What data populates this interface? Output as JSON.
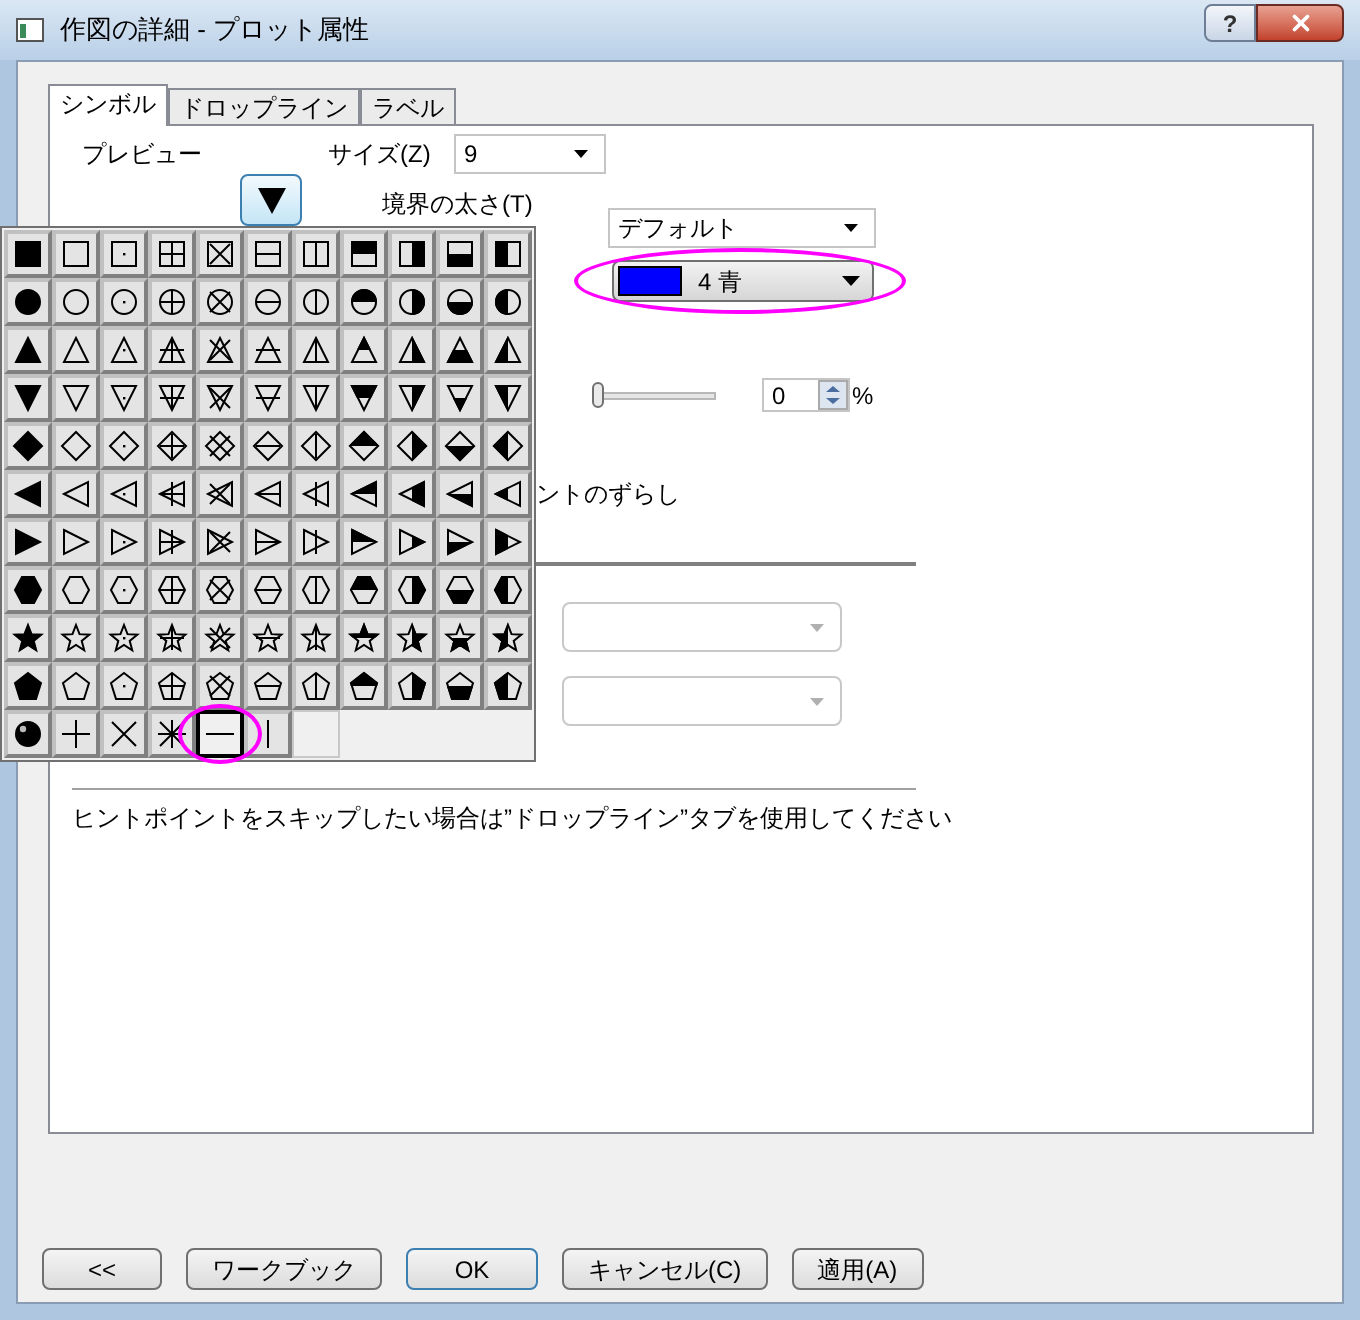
{
  "window": {
    "title": "作図の詳細 - プロット属性",
    "help_button": "?"
  },
  "tabs": [
    {
      "label": "シンボル",
      "selected": true
    },
    {
      "label": "ドロップライン",
      "selected": false
    },
    {
      "label": "ラベル",
      "selected": false
    }
  ],
  "symbol_tab": {
    "preview_label": "プレビュー",
    "size_label": "サイズ(Z)",
    "size_value": "9",
    "border_width_label": "境界の太さ(T)",
    "border_width_value": "デフォルト",
    "color_combo": {
      "color": "#0000ff",
      "label": "4 青"
    },
    "transparency": {
      "level": 0,
      "value": "0",
      "unit": "%"
    },
    "offset_label": "ントのずらし",
    "dropdowns": [
      {
        "disabled": true
      },
      {
        "disabled": true
      }
    ],
    "hint": "ヒントポイントをスキップしたい場合は”ドロップライン”タブを使用してください"
  },
  "symbol_palette": {
    "rows": [
      {
        "kind": "square",
        "cells": [
          {
            "kind": "filled",
            "selected": false
          },
          {
            "kind": "open",
            "selected": false
          },
          {
            "kind": "dot",
            "selected": false
          },
          {
            "kind": "plus",
            "selected": false
          },
          {
            "kind": "x",
            "selected": false
          },
          {
            "kind": "hline",
            "selected": false
          },
          {
            "kind": "vline",
            "selected": false
          },
          {
            "kind": "top",
            "selected": false
          },
          {
            "kind": "right",
            "selected": false
          },
          {
            "kind": "bottom",
            "selected": false
          },
          {
            "kind": "left",
            "selected": false
          }
        ]
      },
      {
        "kind": "circle",
        "cells": [
          {
            "kind": "filled",
            "selected": false
          },
          {
            "kind": "open",
            "selected": false
          },
          {
            "kind": "dot",
            "selected": false
          },
          {
            "kind": "plus",
            "selected": false
          },
          {
            "kind": "x",
            "selected": false
          },
          {
            "kind": "hline",
            "selected": false
          },
          {
            "kind": "vline",
            "selected": false
          },
          {
            "kind": "top",
            "selected": false
          },
          {
            "kind": "right",
            "selected": false
          },
          {
            "kind": "bottom",
            "selected": false
          },
          {
            "kind": "left",
            "selected": false
          }
        ]
      },
      {
        "kind": "up-triangle",
        "cells": [
          {
            "kind": "filled",
            "selected": false
          },
          {
            "kind": "open",
            "selected": false
          },
          {
            "kind": "dot",
            "selected": false
          },
          {
            "kind": "plus",
            "selected": false
          },
          {
            "kind": "x",
            "selected": false
          },
          {
            "kind": "hline",
            "selected": false
          },
          {
            "kind": "vline",
            "selected": false
          },
          {
            "kind": "top",
            "selected": false
          },
          {
            "kind": "right",
            "selected": false
          },
          {
            "kind": "bottom",
            "selected": false
          },
          {
            "kind": "left",
            "selected": false
          }
        ]
      },
      {
        "kind": "down-triangle",
        "cells": [
          {
            "kind": "filled",
            "selected": false
          },
          {
            "kind": "open",
            "selected": false
          },
          {
            "kind": "dot",
            "selected": false
          },
          {
            "kind": "plus",
            "selected": false
          },
          {
            "kind": "x",
            "selected": false
          },
          {
            "kind": "hline",
            "selected": false
          },
          {
            "kind": "vline",
            "selected": false
          },
          {
            "kind": "top",
            "selected": false
          },
          {
            "kind": "right",
            "selected": false
          },
          {
            "kind": "bottom",
            "selected": false
          },
          {
            "kind": "left",
            "selected": false
          }
        ]
      },
      {
        "kind": "diamond",
        "cells": [
          {
            "kind": "filled",
            "selected": false
          },
          {
            "kind": "open",
            "selected": false
          },
          {
            "kind": "dot",
            "selected": false
          },
          {
            "kind": "plus",
            "selected": false
          },
          {
            "kind": "x",
            "selected": false
          },
          {
            "kind": "hline",
            "selected": false
          },
          {
            "kind": "vline",
            "selected": false
          },
          {
            "kind": "top",
            "selected": false
          },
          {
            "kind": "right",
            "selected": false
          },
          {
            "kind": "bottom",
            "selected": false
          },
          {
            "kind": "left",
            "selected": false
          }
        ]
      },
      {
        "kind": "left-triangle",
        "cells": [
          {
            "kind": "filled",
            "selected": false
          },
          {
            "kind": "open",
            "selected": false
          },
          {
            "kind": "dot",
            "selected": false
          },
          {
            "kind": "plus",
            "selected": false
          },
          {
            "kind": "x",
            "selected": false
          },
          {
            "kind": "hline",
            "selected": false
          },
          {
            "kind": "vline",
            "selected": false
          },
          {
            "kind": "top",
            "selected": false
          },
          {
            "kind": "right",
            "selected": false
          },
          {
            "kind": "bottom",
            "selected": false
          },
          {
            "kind": "left",
            "selected": false
          }
        ]
      },
      {
        "kind": "right-triangle",
        "cells": [
          {
            "kind": "filled",
            "selected": false
          },
          {
            "kind": "open",
            "selected": false
          },
          {
            "kind": "dot",
            "selected": false
          },
          {
            "kind": "plus",
            "selected": false
          },
          {
            "kind": "x",
            "selected": false
          },
          {
            "kind": "hline",
            "selected": false
          },
          {
            "kind": "vline",
            "selected": false
          },
          {
            "kind": "top",
            "selected": false
          },
          {
            "kind": "right",
            "selected": false
          },
          {
            "kind": "bottom",
            "selected": false
          },
          {
            "kind": "left",
            "selected": false
          }
        ]
      },
      {
        "kind": "hexagon",
        "cells": [
          {
            "kind": "filled",
            "selected": false
          },
          {
            "kind": "open",
            "selected": false
          },
          {
            "kind": "dot",
            "selected": false
          },
          {
            "kind": "plus",
            "selected": false
          },
          {
            "kind": "x",
            "selected": false
          },
          {
            "kind": "hline",
            "selected": false
          },
          {
            "kind": "vline",
            "selected": false
          },
          {
            "kind": "top",
            "selected": false
          },
          {
            "kind": "right",
            "selected": false
          },
          {
            "kind": "bottom",
            "selected": false
          },
          {
            "kind": "left",
            "selected": false
          }
        ]
      },
      {
        "kind": "star",
        "cells": [
          {
            "kind": "filled",
            "selected": false
          },
          {
            "kind": "open",
            "selected": false
          },
          {
            "kind": "dot",
            "selected": false
          },
          {
            "kind": "plus",
            "selected": false
          },
          {
            "kind": "x",
            "selected": false
          },
          {
            "kind": "hline",
            "selected": false
          },
          {
            "kind": "vline",
            "selected": false
          },
          {
            "kind": "top",
            "selected": false
          },
          {
            "kind": "right",
            "selected": false
          },
          {
            "kind": "bottom",
            "selected": false
          },
          {
            "kind": "left",
            "selected": false
          }
        ]
      },
      {
        "kind": "pentagon",
        "cells": [
          {
            "kind": "filled",
            "selected": false
          },
          {
            "kind": "open",
            "selected": false
          },
          {
            "kind": "dot",
            "selected": false
          },
          {
            "kind": "plus",
            "selected": false
          },
          {
            "kind": "x",
            "selected": false
          },
          {
            "kind": "hline",
            "selected": false
          },
          {
            "kind": "vline",
            "selected": false
          },
          {
            "kind": "top",
            "selected": false
          },
          {
            "kind": "right",
            "selected": false
          },
          {
            "kind": "bottom",
            "selected": false
          },
          {
            "kind": "left",
            "selected": false
          }
        ]
      }
    ],
    "extras": [
      {
        "kind": "sphere",
        "selected": false
      },
      {
        "kind": "plus",
        "selected": false
      },
      {
        "kind": "cross",
        "selected": false
      },
      {
        "kind": "asterisk",
        "selected": false
      },
      {
        "kind": "hbar",
        "selected": true
      },
      {
        "kind": "vbar",
        "selected": false
      },
      {
        "kind": "blank",
        "selected": false
      }
    ]
  },
  "buttons": [
    {
      "label": "<<",
      "default": false
    },
    {
      "label": "ワークブック",
      "default": false
    },
    {
      "label": "OK",
      "default": true
    },
    {
      "label": "キャンセル(C)",
      "default": false
    },
    {
      "label": "適用(A)",
      "default": false
    }
  ]
}
